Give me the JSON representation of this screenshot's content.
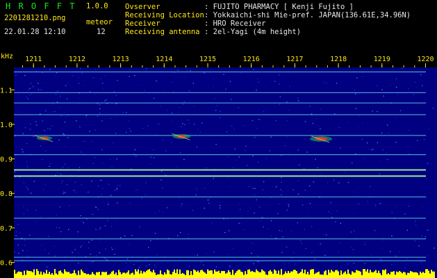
{
  "app": {
    "name": "H R O F F T",
    "version": "1.0.0"
  },
  "file": {
    "name": "2201281210.png",
    "datetime": "22.01.28 12:10"
  },
  "meteor": {
    "label": "meteor",
    "count": "12"
  },
  "info": [
    {
      "label": "Ovserver",
      "value": ": FUJITO PHARMACY [ Kenji Fujito ]"
    },
    {
      "label": "Receiving Location",
      "value": ": Yokkaichi-shi Mie-pref. JAPAN(136.61E,34.96N)"
    },
    {
      "label": "Receiver",
      "value": ": HRO Receiver"
    },
    {
      "label": "Receiving antenna",
      "value": ": 2el-Yagi (4m height)"
    }
  ],
  "axis": {
    "unit": "kHz",
    "time_ticks": [
      "1211",
      "1212",
      "1213",
      "1214",
      "1215",
      "1216",
      "1217",
      "1218",
      "1219",
      "1220"
    ],
    "freq_ticks": [
      "1.1",
      "1.0",
      "0.9",
      "0.8",
      "0.7",
      "0.6"
    ],
    "freq_min": 0.585,
    "freq_max": 1.165
  },
  "carriers_khz": [
    1.152,
    1.092,
    1.062,
    1.028,
    0.968,
    0.912,
    0.868,
    0.85,
    0.79,
    0.728,
    0.668,
    0.615,
    0.605
  ],
  "echoes": [
    {
      "t": 1211.25,
      "f": 0.96,
      "strength": 0.7
    },
    {
      "t": 1214.4,
      "f": 0.965,
      "strength": 0.8
    },
    {
      "t": 1217.6,
      "f": 0.958,
      "strength": 1.0
    }
  ],
  "colors": {
    "background": "#000080",
    "carrier": "#6ef0ff",
    "label_green": "#19e619",
    "label_yellow": "#ffe81a"
  }
}
